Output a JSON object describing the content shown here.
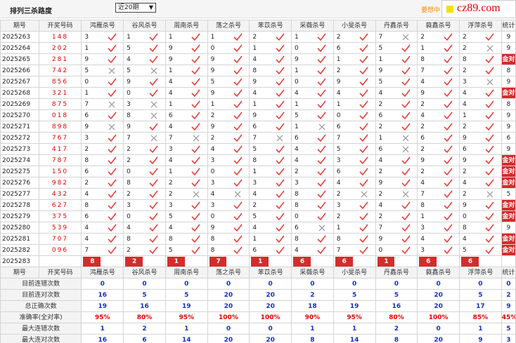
{
  "header": {
    "title": "排列三杀路度",
    "period_select": "近20期",
    "promo": "要想中",
    "logo_text": "cz89.com"
  },
  "columns": {
    "period": "期号",
    "result": "开奖号码",
    "experts": [
      "鸿雁杀号",
      "谷风杀号",
      "周南杀号",
      "荡之杀号",
      "苯苡杀号",
      "采薇杀号",
      "小旻杀号",
      "丹鑫杀号",
      "蕤鑫杀号",
      "浮萍杀号"
    ],
    "stat": "统计"
  },
  "rows": [
    {
      "period": "2025263",
      "result": "148",
      "nums": [
        "3",
        "1",
        "1",
        "1",
        "2",
        "1",
        "2",
        "7",
        "2",
        "2"
      ],
      "ok": [
        1,
        1,
        1,
        1,
        1,
        1,
        1,
        0,
        1,
        1
      ],
      "stat": "9"
    },
    {
      "period": "2025264",
      "result": "202",
      "nums": [
        "1",
        "5",
        "9",
        "0",
        "1",
        "0",
        "6",
        "5",
        "1",
        "2"
      ],
      "ok": [
        1,
        1,
        1,
        1,
        1,
        1,
        1,
        1,
        1,
        0
      ],
      "stat": "9"
    },
    {
      "period": "2025265",
      "result": "281",
      "nums": [
        "9",
        "4",
        "9",
        "9",
        "4",
        "9",
        "1",
        "1",
        "8",
        "8"
      ],
      "ok": [
        1,
        1,
        1,
        1,
        1,
        1,
        1,
        1,
        1,
        1
      ],
      "stat": "金对"
    },
    {
      "period": "2025266",
      "result": "742",
      "nums": [
        "5",
        "5",
        "1",
        "9",
        "8",
        "1",
        "2",
        "9",
        "7",
        "2"
      ],
      "ok": [
        0,
        0,
        1,
        1,
        1,
        1,
        1,
        1,
        1,
        1
      ],
      "stat": "8"
    },
    {
      "period": "2025267",
      "result": "856",
      "nums": [
        "0",
        "9",
        "4",
        "5",
        "9",
        "0",
        "9",
        "5",
        "4",
        "3"
      ],
      "ok": [
        1,
        1,
        1,
        1,
        1,
        1,
        1,
        1,
        1,
        0
      ],
      "stat": "9"
    },
    {
      "period": "2025268",
      "result": "321",
      "nums": [
        "1",
        "0",
        "4",
        "9",
        "4",
        "4",
        "4",
        "4",
        "9",
        "4"
      ],
      "ok": [
        1,
        1,
        1,
        1,
        1,
        1,
        1,
        1,
        1,
        1
      ],
      "stat": "金对"
    },
    {
      "period": "2025269",
      "result": "875",
      "nums": [
        "7",
        "3",
        "1",
        "1",
        "1",
        "1",
        "1",
        "2",
        "2",
        "4"
      ],
      "ok": [
        0,
        0,
        1,
        1,
        1,
        1,
        1,
        1,
        1,
        1
      ],
      "stat": "8"
    },
    {
      "period": "2025270",
      "result": "018",
      "nums": [
        "6",
        "8",
        "6",
        "2",
        "9",
        "5",
        "0",
        "6",
        "4",
        "1"
      ],
      "ok": [
        1,
        0,
        1,
        1,
        1,
        1,
        1,
        1,
        1,
        1
      ],
      "stat": "9"
    },
    {
      "period": "2025271",
      "result": "898",
      "nums": [
        "9",
        "9",
        "4",
        "9",
        "6",
        "1",
        "6",
        "2",
        "2",
        "2"
      ],
      "ok": [
        0,
        1,
        1,
        1,
        1,
        0,
        1,
        1,
        1,
        1
      ],
      "stat": "9"
    },
    {
      "period": "2025272",
      "result": "767",
      "nums": [
        "3",
        "7",
        "7",
        "2",
        "7",
        "6",
        "7",
        "1",
        "6",
        "9"
      ],
      "ok": [
        1,
        0,
        0,
        1,
        0,
        1,
        1,
        0,
        1,
        1
      ],
      "stat": "6"
    },
    {
      "period": "2025273",
      "result": "417",
      "nums": [
        "2",
        "2",
        "3",
        "4",
        "5",
        "4",
        "5",
        "6",
        "2",
        "6"
      ],
      "ok": [
        1,
        1,
        1,
        1,
        1,
        1,
        1,
        0,
        1,
        1
      ],
      "stat": "9"
    },
    {
      "period": "2025274",
      "result": "787",
      "nums": [
        "8",
        "2",
        "4",
        "3",
        "8",
        "4",
        "3",
        "4",
        "9",
        "9"
      ],
      "ok": [
        1,
        1,
        1,
        1,
        1,
        1,
        1,
        1,
        1,
        1
      ],
      "stat": "金对"
    },
    {
      "period": "2025275",
      "result": "150",
      "nums": [
        "6",
        "0",
        "1",
        "0",
        "1",
        "2",
        "6",
        "2",
        "2",
        "2"
      ],
      "ok": [
        1,
        1,
        1,
        1,
        1,
        1,
        1,
        1,
        1,
        1
      ],
      "stat": "金对"
    },
    {
      "period": "2025276",
      "result": "982",
      "nums": [
        "2",
        "8",
        "2",
        "3",
        "3",
        "3",
        "4",
        "9",
        "4",
        "4"
      ],
      "ok": [
        1,
        1,
        1,
        1,
        1,
        1,
        1,
        1,
        1,
        1
      ],
      "stat": "金对"
    },
    {
      "period": "2025277",
      "result": "432",
      "nums": [
        "4",
        "2",
        "2",
        "4",
        "4",
        "8",
        "2",
        "2",
        "7",
        "2"
      ],
      "ok": [
        1,
        1,
        0,
        0,
        1,
        1,
        0,
        0,
        1,
        0
      ],
      "stat": "5"
    },
    {
      "period": "2025278",
      "result": "627",
      "nums": [
        "8",
        "3",
        "3",
        "3",
        "2",
        "8",
        "3",
        "4",
        "8",
        "9"
      ],
      "ok": [
        1,
        1,
        1,
        1,
        1,
        1,
        1,
        1,
        1,
        1
      ],
      "stat": "金对"
    },
    {
      "period": "2025279",
      "result": "375",
      "nums": [
        "6",
        "0",
        "5",
        "0",
        "5",
        "0",
        "2",
        "2",
        "1",
        "0"
      ],
      "ok": [
        1,
        1,
        1,
        1,
        1,
        1,
        1,
        1,
        1,
        1
      ],
      "stat": "金对"
    },
    {
      "period": "2025280",
      "result": "539",
      "nums": [
        "4",
        "4",
        "4",
        "9",
        "4",
        "6",
        "1",
        "7",
        "3",
        "8"
      ],
      "ok": [
        1,
        1,
        1,
        1,
        1,
        0,
        1,
        1,
        1,
        1
      ],
      "stat": "9"
    },
    {
      "period": "2025281",
      "result": "707",
      "nums": [
        "4",
        "8",
        "8",
        "8",
        "1",
        "8",
        "8",
        "9",
        "4",
        "4"
      ],
      "ok": [
        1,
        1,
        1,
        1,
        1,
        1,
        1,
        1,
        1,
        1
      ],
      "stat": "金对"
    },
    {
      "period": "2025282",
      "result": "096",
      "nums": [
        "7",
        "2",
        "5",
        "8",
        "6",
        "4",
        "7",
        "0",
        "3",
        "5"
      ],
      "ok": [
        1,
        1,
        1,
        1,
        1,
        1,
        1,
        1,
        1,
        1
      ],
      "stat": "金对"
    }
  ],
  "current": {
    "period": "2025283",
    "label": "当前期杀号",
    "kills": [
      "8",
      "2",
      "1",
      "7",
      "1",
      "6",
      "6",
      "1",
      "6",
      "6"
    ]
  },
  "stats": [
    {
      "label": "目前连错次数",
      "values": [
        "0",
        "0",
        "0",
        "0",
        "0",
        "0",
        "0",
        "0",
        "0",
        "0",
        "0"
      ]
    },
    {
      "label": "目前连对次数",
      "values": [
        "16",
        "5",
        "5",
        "20",
        "20",
        "2",
        "5",
        "5",
        "20",
        "5",
        "2"
      ]
    },
    {
      "label": "总正确次数",
      "values": [
        "19",
        "16",
        "19",
        "20",
        "20",
        "18",
        "19",
        "16",
        "20",
        "17",
        "9"
      ]
    },
    {
      "label": "准确率(全对率)",
      "values": [
        "95%",
        "80%",
        "95%",
        "100%",
        "100%",
        "90%",
        "95%",
        "80%",
        "100%",
        "85%",
        "45%"
      ]
    },
    {
      "label": "最大连错次数",
      "values": [
        "1",
        "2",
        "1",
        "0",
        "0",
        "1",
        "1",
        "2",
        "0",
        "1",
        "5"
      ]
    },
    {
      "label": "最大连对次数",
      "values": [
        "16",
        "6",
        "14",
        "20",
        "20",
        "8",
        "14",
        "8",
        "20",
        "9",
        "3"
      ]
    }
  ]
}
